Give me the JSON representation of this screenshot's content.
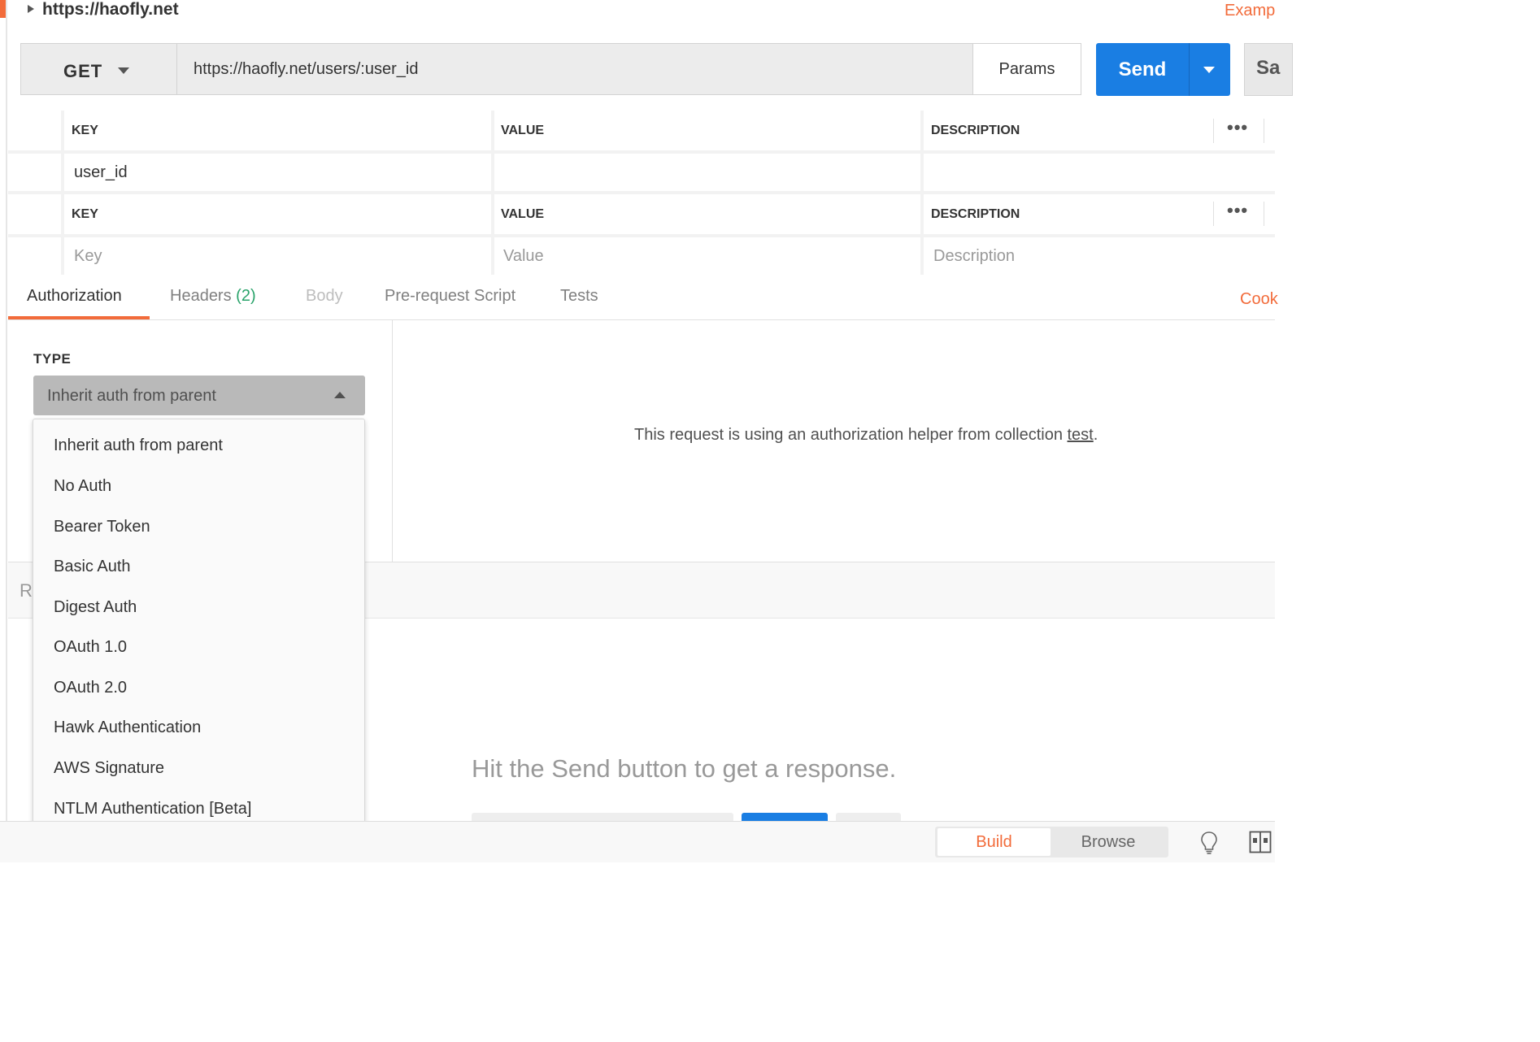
{
  "request": {
    "title": "https://haofly.net",
    "examples_label": "Examp",
    "method": "GET",
    "url": "https://haofly.net/users/:user_id",
    "params_label": "Params",
    "send_label": "Send",
    "save_label": "Sa"
  },
  "path_variables": {
    "headers": [
      "KEY",
      "VALUE",
      "DESCRIPTION"
    ],
    "rows": [
      {
        "key": "user_id",
        "value": "",
        "description": ""
      }
    ]
  },
  "query_params": {
    "headers": [
      "KEY",
      "VALUE",
      "DESCRIPTION"
    ],
    "placeholders": {
      "key": "Key",
      "value": "Value",
      "description": "Description"
    }
  },
  "tabs": [
    {
      "label": "Authorization"
    },
    {
      "label": "Headers",
      "count": "(2)"
    },
    {
      "label": "Body"
    },
    {
      "label": "Pre-request Script"
    },
    {
      "label": "Tests"
    }
  ],
  "cookies_label": "Cook",
  "auth": {
    "type_label": "TYPE",
    "selected": "Inherit auth from parent",
    "info_text": "This request is using an authorization helper from collection ",
    "info_link": "test",
    "info_suffix": ".",
    "options": [
      "Inherit auth from parent",
      "No Auth",
      "Bearer Token",
      "Basic Auth",
      "Digest Auth",
      "OAuth 1.0",
      "OAuth 2.0",
      "Hawk Authentication",
      "AWS Signature",
      "NTLM Authentication [Beta]"
    ]
  },
  "response": {
    "label": "R",
    "empty_message": "Hit the Send button to get a response."
  },
  "footer": {
    "build_label": "Build",
    "browse_label": "Browse"
  },
  "colors": {
    "accent": "#f26b3a",
    "primary": "#1a7ee3",
    "success": "#29a36a"
  }
}
